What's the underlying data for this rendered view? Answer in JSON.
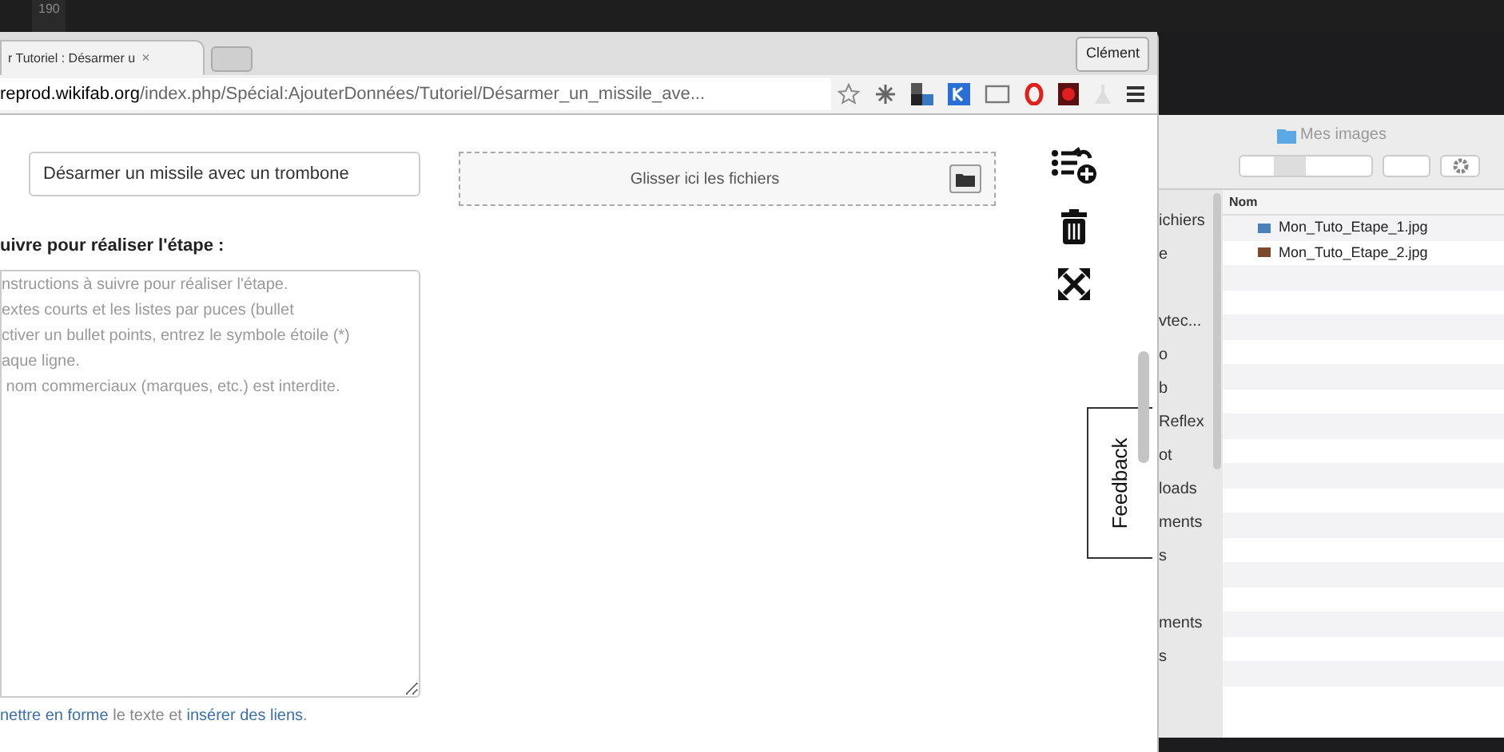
{
  "editor_strip": {
    "line_number": "190"
  },
  "browser": {
    "tab": {
      "title": "r Tutoriel : Désarmer u",
      "close": "×"
    },
    "profile": "Clément",
    "address": {
      "host": "reprod.wikifab.org",
      "path": "/index.php/Spécial:AjouterDonnées/Tutoriel/Désarmer_un_missile_ave..."
    },
    "form": {
      "title_value": "Désarmer un missile avec un trombone",
      "dropzone": "Glisser ici les fichiers",
      "label": "uivre pour réaliser l'étape :",
      "textarea_placeholder": "nstructions à suivre pour réaliser l'étape.\nextes courts et les listes par puces (bullet\nctiver un bullet points, entrez le symbole étoile (*)\naque ligne.\n nom commerciaux (marques, etc.) est interdite.",
      "help": [
        {
          "kind": "link",
          "text": "nettre en forme"
        },
        {
          "kind": "text",
          "text": " le texte et "
        },
        {
          "kind": "link",
          "text": "insérer des liens"
        },
        {
          "kind": "text",
          "text": "."
        }
      ]
    },
    "feedback": "Feedback"
  },
  "finder": {
    "title": "Mes images",
    "column": "Nom",
    "sidebar_groups": [
      [
        "ichiers",
        "e"
      ],
      [
        "vtec...",
        "o",
        "b",
        "Reflex",
        "ot",
        "loads",
        "ments",
        "s"
      ],
      [
        "ments",
        "s"
      ]
    ],
    "files": [
      {
        "name": "Mon_Tuto_Etape_1.jpg",
        "color": "#4a7fb8"
      },
      {
        "name": "Mon_Tuto_Etape_2.jpg",
        "color": "#7a4a2a"
      }
    ]
  }
}
